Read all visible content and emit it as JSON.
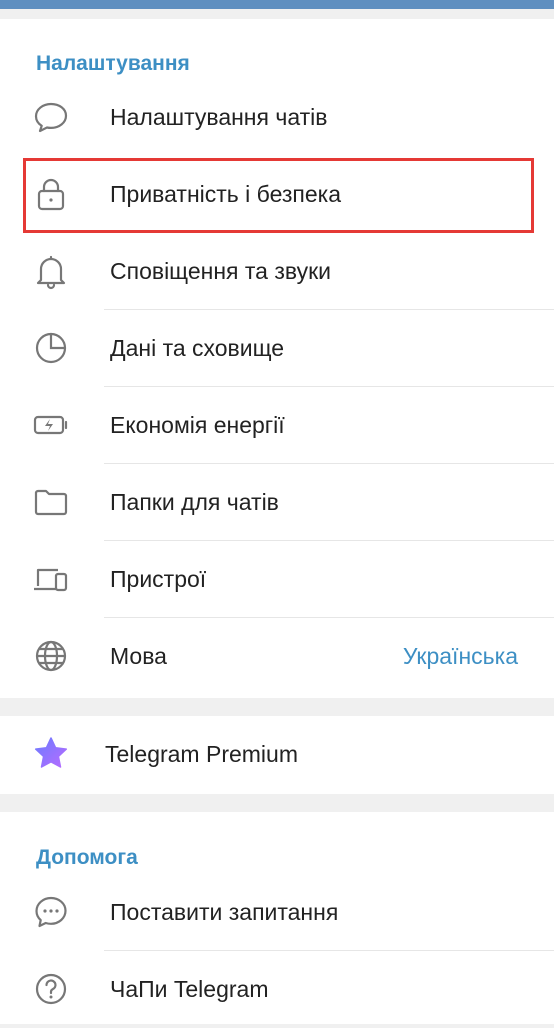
{
  "settings": {
    "section_title": "Налаштування",
    "items": [
      {
        "label": "Налаштування чатів",
        "icon": "chat-bubble-icon"
      },
      {
        "label": "Приватність і безпека",
        "icon": "lock-icon"
      },
      {
        "label": "Сповіщення та звуки",
        "icon": "bell-icon"
      },
      {
        "label": "Дані та сховище",
        "icon": "pie-chart-icon"
      },
      {
        "label": "Економія енергії",
        "icon": "battery-icon"
      },
      {
        "label": "Папки для чатів",
        "icon": "folder-icon"
      },
      {
        "label": "Пристрої",
        "icon": "devices-icon"
      },
      {
        "label": "Мова",
        "icon": "globe-icon",
        "value": "Українська"
      }
    ]
  },
  "premium": {
    "label": "Telegram Premium",
    "icon": "star-icon"
  },
  "help": {
    "section_title": "Допомога",
    "items": [
      {
        "label": "Поставити запитання",
        "icon": "chat-dots-icon"
      },
      {
        "label": "ЧаПи Telegram",
        "icon": "question-icon"
      }
    ]
  },
  "colors": {
    "accent": "#3d8fc4",
    "highlight_border": "#e53935",
    "top_bar": "#5f8fc0",
    "background": "#f0f0f0",
    "star_gradient": [
      "#6b7cff",
      "#b86bff"
    ]
  }
}
